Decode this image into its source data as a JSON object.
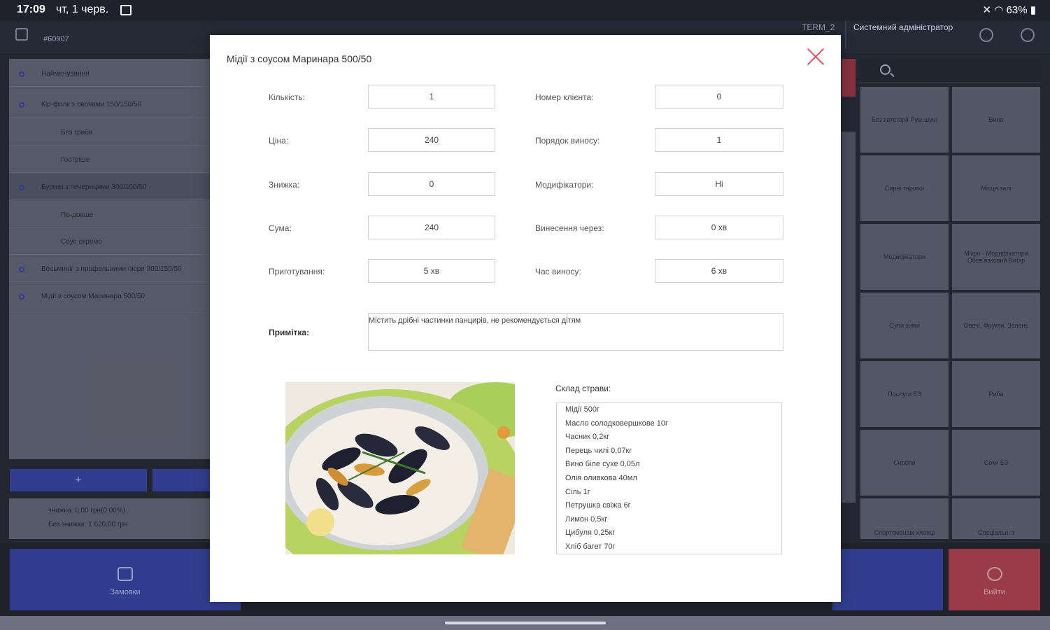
{
  "status": {
    "time": "17:09",
    "date": "чт, 1 черв.",
    "battery": "63%"
  },
  "topbar": {
    "order_no": "#60907",
    "term": "TERM_2",
    "user": "Системний адміністратор"
  },
  "order_list": [
    {
      "label": "Найменування",
      "sub": false,
      "highlight": false
    },
    {
      "label": "Кір-фолк з овочами 150/150/50",
      "sub": false,
      "highlight": false
    },
    {
      "label": "Без гриба",
      "sub": true,
      "highlight": false
    },
    {
      "label": "Гостріше",
      "sub": true,
      "highlight": false
    },
    {
      "label": "Бургер з печерицями 300/100/50",
      "sub": false,
      "highlight": true
    },
    {
      "label": "По-довше",
      "sub": true,
      "highlight": false
    },
    {
      "label": "Соус окремо",
      "sub": true,
      "highlight": false
    },
    {
      "label": "Восьминіг з профельними пюре 300/150/50",
      "sub": false,
      "highlight": false
    },
    {
      "label": "Мідії з соусом Маринара 500/50",
      "sub": false,
      "highlight": false
    }
  ],
  "left_buttons": {
    "add": "+"
  },
  "totals": {
    "line1": "знижка: 0,00 грн(0.00%)",
    "line2": "Без знижки: 1 620,00 грн"
  },
  "bottom_buttons": {
    "orders": "Замовки",
    "exit": "Вийти"
  },
  "tiles": [
    "Без категорії Рум-шуш",
    "Вино",
    "Сирні тарілки",
    "Місця залі",
    "Модифікатори",
    "Мікро - Модифікатори Обов'язковий Вибір",
    "Супи зими",
    "Овочі, Фрукти, Зелень",
    "Послуги ЕЗ",
    "Риба",
    "Сиропи",
    "Соки ЕЗ",
    "Спортсменам хлопці",
    "Спеціальні з"
  ],
  "modal": {
    "title": "Мідії з соусом Маринара 500/50",
    "fields_left": [
      {
        "label": "Кількість:",
        "value": "1"
      },
      {
        "label": "Ціна:",
        "value": "240"
      },
      {
        "label": "Знижка:",
        "value": "0"
      },
      {
        "label": "Сума:",
        "value": "240"
      },
      {
        "label": "Приготування:",
        "value": "5 хв"
      }
    ],
    "fields_right": [
      {
        "label": "Номер клієнта:",
        "value": "0"
      },
      {
        "label": "Порядок виносу:",
        "value": "1"
      },
      {
        "label": "Модифікатори:",
        "value": "Ні"
      },
      {
        "label": "Винесення через:",
        "value": "0 хв"
      },
      {
        "label": "Час виносу:",
        "value": "6 хв"
      }
    ],
    "note_label": "Примітка:",
    "note_value": "Містить дрібні частинки панцирів, не рекомендується дітям",
    "composition_label": "Склад страви:",
    "composition": [
      "Мідії 500г",
      "Масло солодковершкове 10г",
      "Часник 0,2кг",
      "Перець чилі 0,07кг",
      "Вино біле сухе 0,05л",
      "Олія оливкова 40мл",
      "Сіль 1г",
      "Петрушка свіжа 6г",
      "Лимон 0,5кг",
      "Цибуля 0,25кг",
      "Хліб багет 70г"
    ]
  }
}
